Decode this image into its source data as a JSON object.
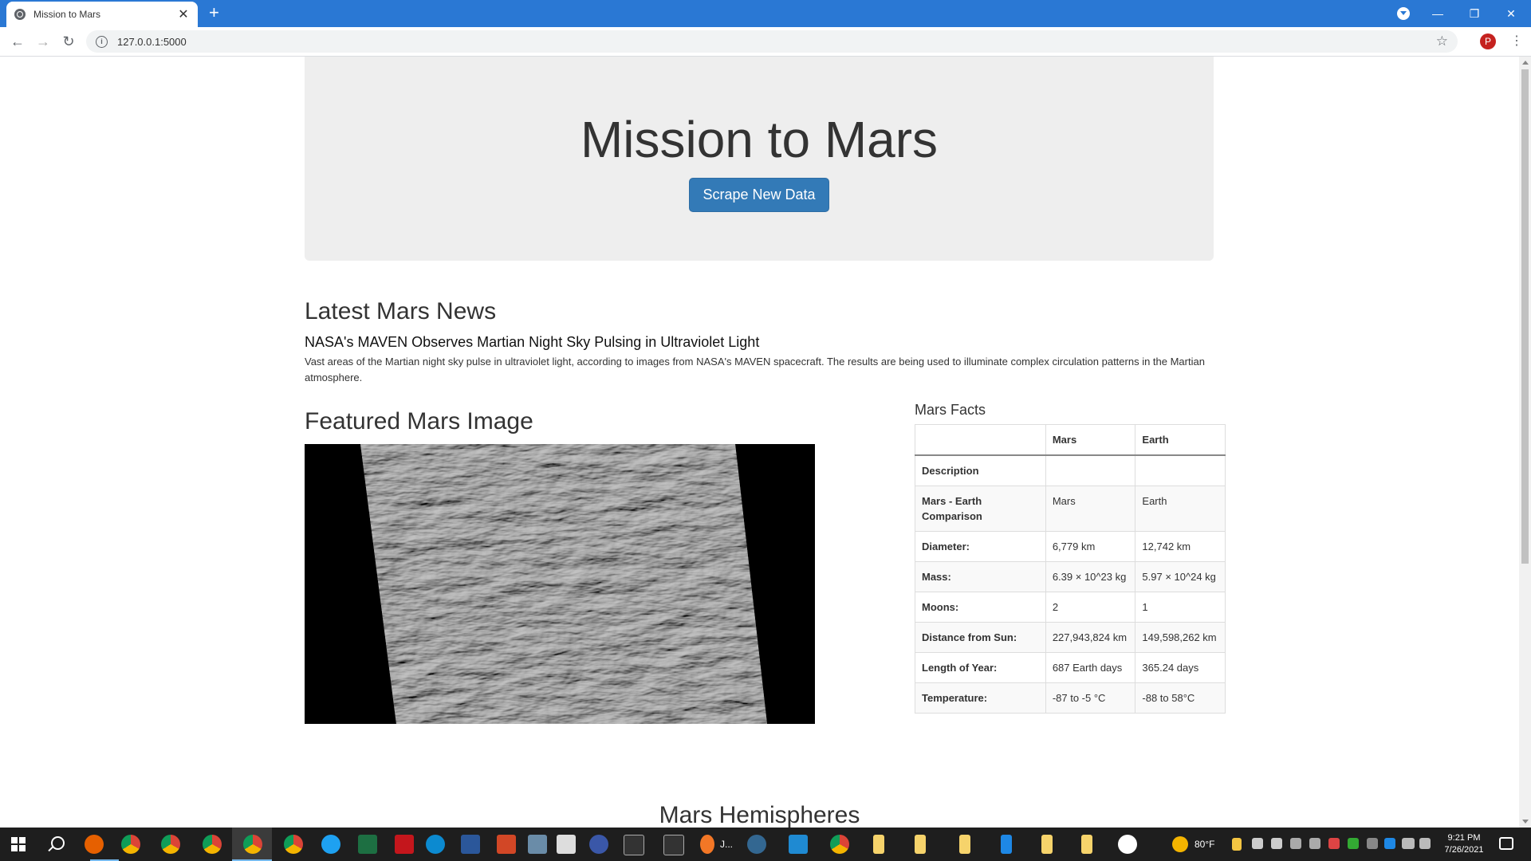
{
  "browser": {
    "tab_title": "Mission to Mars",
    "tab_close": "✕",
    "new_tab": "+",
    "url": "127.0.0.1:5000",
    "avatar_letter": "P"
  },
  "hero": {
    "title": "Mission to Mars",
    "button_label": "Scrape New Data"
  },
  "news": {
    "heading": "Latest Mars News",
    "title": "NASA's MAVEN Observes Martian Night Sky Pulsing in Ultraviolet Light",
    "paragraph": "Vast areas of the Martian night sky pulse in ultraviolet light, according to images from NASA's MAVEN spacecraft. The results are being used to illuminate complex circulation patterns in the Martian atmosphere."
  },
  "featured": {
    "heading": "Featured Mars Image"
  },
  "facts": {
    "heading": "Mars Facts",
    "columns": [
      "",
      "Mars",
      "Earth"
    ],
    "rows": [
      [
        "Description",
        "",
        ""
      ],
      [
        "Mars - Earth Comparison",
        "Mars",
        "Earth"
      ],
      [
        "Diameter:",
        "6,779 km",
        "12,742 km"
      ],
      [
        "Mass:",
        "6.39 × 10^23 kg",
        "5.97 × 10^24 kg"
      ],
      [
        "Moons:",
        "2",
        "1"
      ],
      [
        "Distance from Sun:",
        "227,943,824 km",
        "149,598,262 km"
      ],
      [
        "Length of Year:",
        "687 Earth days",
        "365.24 days"
      ],
      [
        "Temperature:",
        "-87 to -5 °C",
        "-88 to 58°C"
      ]
    ]
  },
  "hemispheres": {
    "heading": "Mars Hemispheres"
  },
  "taskbar": {
    "weather": "80°F",
    "time": "9:21 PM",
    "date": "7/26/2021",
    "java_label": "J..."
  }
}
